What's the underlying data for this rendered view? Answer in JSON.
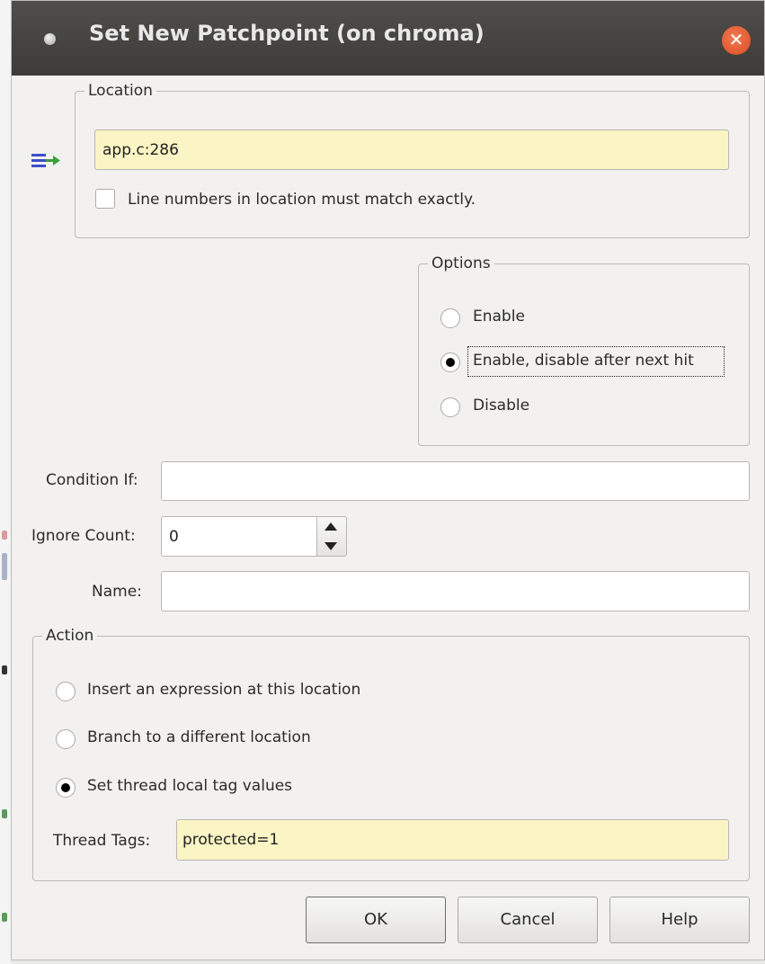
{
  "window": {
    "title": "Set New Patchpoint (on chroma)",
    "close_icon": "close-icon"
  },
  "location": {
    "legend": "Location",
    "value": "app.c:286",
    "exact_match_label": "Line numbers in location must match exactly.",
    "exact_match_checked": false
  },
  "options": {
    "legend": "Options",
    "items": [
      {
        "label": "Enable",
        "selected": false
      },
      {
        "label": "Enable, disable after next hit",
        "selected": true
      },
      {
        "label": "Disable",
        "selected": false
      }
    ]
  },
  "condition": {
    "label": "Condition If:",
    "value": ""
  },
  "ignore_count": {
    "label": "Ignore Count:",
    "value": "0"
  },
  "name": {
    "label": "Name:",
    "value": ""
  },
  "action": {
    "legend": "Action",
    "items": [
      {
        "label": "Insert an expression at this location",
        "selected": false
      },
      {
        "label": "Branch to a different location",
        "selected": false
      },
      {
        "label": "Set thread local tag values",
        "selected": true
      }
    ],
    "thread_tags_label": "Thread Tags:",
    "thread_tags_value": "protected=1"
  },
  "buttons": {
    "ok": "OK",
    "cancel": "Cancel",
    "help": "Help"
  },
  "colors": {
    "titlebar": "#3d3c39",
    "close": "#e0542a",
    "entry_highlight": "#fbf4c4",
    "window_bg": "#f2f1f0"
  }
}
